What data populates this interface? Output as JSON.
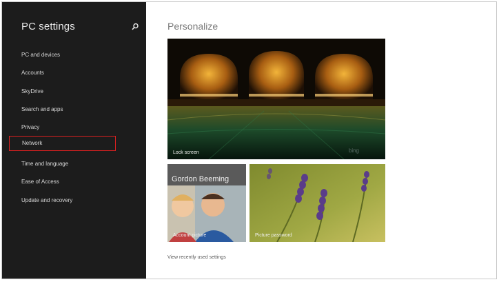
{
  "sidebar": {
    "title": "PC settings",
    "items": [
      {
        "label": "PC and devices"
      },
      {
        "label": "Accounts"
      },
      {
        "label": "SkyDrive"
      },
      {
        "label": "Search and apps"
      },
      {
        "label": "Privacy"
      },
      {
        "label": "Network"
      },
      {
        "label": "Time and language"
      },
      {
        "label": "Ease of Access"
      },
      {
        "label": "Update and recovery"
      }
    ],
    "highlighted_item": "Network",
    "search_icon": "search-icon"
  },
  "main": {
    "title": "Personalize",
    "lock_screen": {
      "label": "Lock screen",
      "watermark": "bing"
    },
    "account_picture": {
      "name": "Gordon Beeming",
      "label": "Account picture"
    },
    "picture_password": {
      "label": "Picture password"
    },
    "recent_link": "View recently used settings"
  },
  "colors": {
    "sidebar_bg": "#1c1c1c",
    "highlight_border": "#e02020",
    "title_gray": "#7a7a7a"
  }
}
